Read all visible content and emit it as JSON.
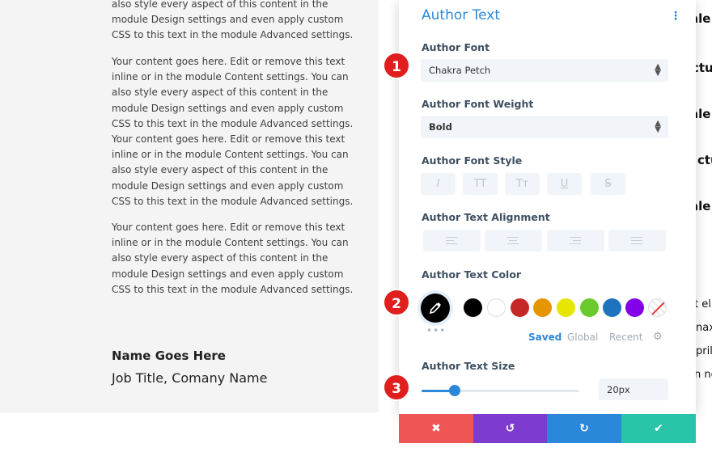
{
  "page": {
    "paragraphs": [
      "also style every aspect of this content in the module Design settings and even apply custom CSS to this text in the module Advanced settings.",
      "Your content goes here. Edit or remove this text inline or in the module Content settings. You can also style every aspect of this content in the module Design settings and even apply custom CSS to this text in the module Advanced settings. Your content goes here. Edit or remove this text inline or in the module Content settings. You can also style every aspect of this content in the module Design settings and even apply custom CSS to this text in the module Advanced settings.",
      "Your content goes here. Edit or remove this text inline or in the module Content settings. You can also style every aspect of this content in the module Design settings and even apply custom CSS to this text in the module Advanced settings."
    ],
    "author_name": "Name Goes Here",
    "author_title": "Job Title, Comany Name"
  },
  "background_fragments": [
    "ale",
    "ctu",
    "ale",
    "ctu",
    "ale",
    "t el",
    "nax",
    "pril",
    "n ne"
  ],
  "panel": {
    "title": "Author Text",
    "menu_icon": "kebab-menu-icon",
    "font_label": "Author Font",
    "font_value": "Chakra Petch",
    "weight_label": "Author Font Weight",
    "weight_value": "Bold",
    "style_label": "Author Font Style",
    "style_buttons": [
      "I",
      "TT",
      "Tт",
      "U",
      "S"
    ],
    "alignment_label": "Author Text Alignment",
    "alignment_options": [
      "align-left-icon",
      "align-center-icon",
      "align-right-icon",
      "align-justify-icon"
    ],
    "color_label": "Author Text Color",
    "swatches": [
      "#000000",
      "#ffffff",
      "#c62828",
      "#e69500",
      "#e6e600",
      "#6ac92c",
      "#1e73be",
      "#8300e9",
      "none"
    ],
    "color_tabs": [
      "Saved",
      "Global",
      "Recent"
    ],
    "active_tab": "Saved",
    "size_label": "Author Text Size",
    "size_value": "20px",
    "size_fraction": 0.21
  },
  "footer": {
    "cancel": "✖",
    "undo": "↺",
    "redo": "↻",
    "save": "✔"
  },
  "badges": [
    "1",
    "2",
    "3"
  ],
  "colors": {
    "accent": "#2b87da",
    "cancel": "#ef5555",
    "undo": "#7e3bd0",
    "redo": "#2b87da",
    "save": "#29c4a9",
    "badge": "#e01e1e"
  }
}
